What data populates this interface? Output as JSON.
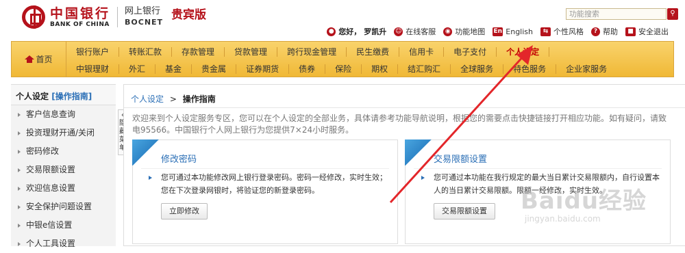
{
  "header": {
    "logo_cn": "中国银行",
    "logo_en": "BANK OF CHINA",
    "sub_cn": "网上银行",
    "sub_en": "BOCNET",
    "vip_label": "贵宾版",
    "search_placeholder": "功能搜索",
    "greeting": "您好，",
    "user_name": "罗凯升",
    "links": {
      "online_msg": "在线客服",
      "site_map": "功能地图",
      "english": "English",
      "style": "个性风格",
      "help": "帮助",
      "logout": "安全退出"
    }
  },
  "nav": {
    "home": "首页",
    "row1": [
      "银行账户",
      "转账汇款",
      "存款管理",
      "贷款管理",
      "跨行现金管理",
      "民生缴费",
      "信用卡",
      "电子支付",
      "个人设定"
    ],
    "row2": [
      "中银理财",
      "外汇",
      "基金",
      "贵金属",
      "证券期货",
      "债券",
      "保险",
      "期权",
      "结汇购汇",
      "全球服务",
      "特色服务",
      "企业家服务"
    ],
    "active": "个人设定"
  },
  "sidebar": {
    "title": "个人设定",
    "guide": "[操作指南]",
    "items": [
      "客户信息查询",
      "投资理财开通/关闭",
      "密码修改",
      "交易限额设置",
      "欢迎信息设置",
      "安全保护问题设置",
      "中银e信设置",
      "个人工具设置"
    ],
    "hide_tab": "隐藏菜单"
  },
  "main": {
    "crumb_parent": "个人设定",
    "crumb_sep": ">",
    "crumb_current": "操作指南",
    "intro": "欢迎来到个人设定服务专区，您可以在个人设定的全部业务，具体请参考功能导航说明，根据您的需要点击快捷链接打开相应功能。如有疑问，请致电95566。中国银行个人网上银行为您提供7×24小时服务。",
    "cards": [
      {
        "title": "修改密码",
        "desc": "您可通过本功能修改网上银行登录密码。密码一经修改，实时生效；您在下次登录网银时，将验证您的新登录密码。",
        "button": "立即修改"
      },
      {
        "title": "交易限额设置",
        "desc": "您可通过本功能在我行规定的最大当日累计交易限额内，自行设置本人的当日累计交易限额。限额一经修改，实时生效。",
        "button": "交易限额设置"
      }
    ]
  },
  "watermark": {
    "brand": "Baidu经验",
    "url": "jingyan.baidu.com"
  },
  "colors": {
    "brand_red": "#b5121b",
    "nav_gold": "#f0b836",
    "link_blue": "#2b6fb6",
    "annotation_arrow": "#e3262a"
  }
}
